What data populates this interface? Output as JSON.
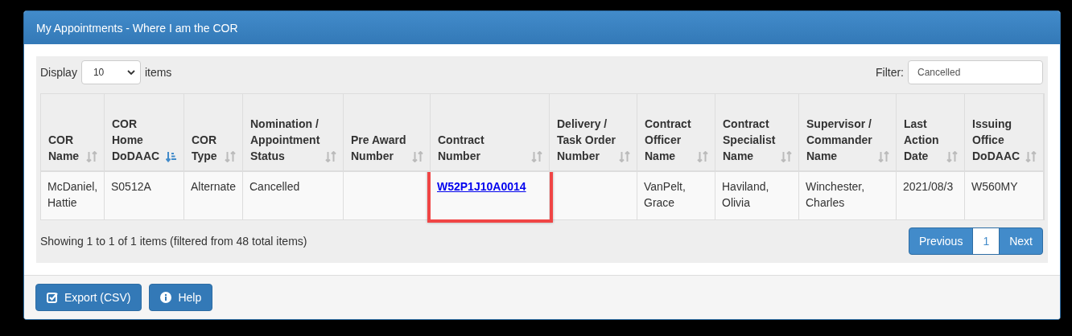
{
  "panel": {
    "title": "My Appointments - Where I am the COR"
  },
  "display": {
    "label": "Display",
    "value": "10",
    "suffix": "items"
  },
  "filter": {
    "label": "Filter:",
    "value": "Cancelled"
  },
  "table": {
    "columns": [
      {
        "label": "COR Name",
        "sorted": false,
        "highlighted": false
      },
      {
        "label": "COR Home DoDAAC",
        "sorted": true,
        "highlighted": false
      },
      {
        "label": "COR Type",
        "sorted": false,
        "highlighted": false
      },
      {
        "label": "Nomination / Appointment Status",
        "sorted": false,
        "highlighted": false
      },
      {
        "label": "Pre Award Number",
        "sorted": false,
        "highlighted": false
      },
      {
        "label": "Contract Number",
        "sorted": false,
        "highlighted": true
      },
      {
        "label": "Delivery / Task Order Number",
        "sorted": false,
        "highlighted": false
      },
      {
        "label": "Contract Officer Name",
        "sorted": false,
        "highlighted": false
      },
      {
        "label": "Contract Specialist Name",
        "sorted": false,
        "highlighted": false
      },
      {
        "label": "Supervisor / Commander Name",
        "sorted": false,
        "highlighted": false
      },
      {
        "label": "Last Action Date",
        "sorted": false,
        "highlighted": false
      },
      {
        "label": "Issuing Office DoDAAC",
        "sorted": false,
        "highlighted": false
      }
    ],
    "rows": [
      {
        "cells": [
          {
            "kind": "text",
            "text": "McDaniel, Hattie"
          },
          {
            "kind": "text",
            "text": "S0512A"
          },
          {
            "kind": "text",
            "text": "Alternate"
          },
          {
            "kind": "text",
            "text": "Cancelled"
          },
          {
            "kind": "empty"
          },
          {
            "kind": "link",
            "text": "W52P1J10A0014"
          },
          {
            "kind": "empty"
          },
          {
            "kind": "text",
            "text": "VanPelt, Grace"
          },
          {
            "kind": "text",
            "text": "Haviland, Olivia"
          },
          {
            "kind": "text",
            "text": "Winchester, Charles"
          },
          {
            "kind": "text",
            "text": "2021/08/3"
          },
          {
            "kind": "text",
            "text": "W560MY"
          }
        ]
      }
    ]
  },
  "summary": "Showing 1 to 1 of 1 items (filtered from 48 total items)",
  "pagination": [
    {
      "label": "Previous",
      "selected": false
    },
    {
      "label": "1",
      "selected": true
    },
    {
      "label": "Next",
      "selected": false
    }
  ],
  "buttons": [
    {
      "label": "Export (CSV)"
    },
    {
      "label": "Help"
    }
  ]
}
